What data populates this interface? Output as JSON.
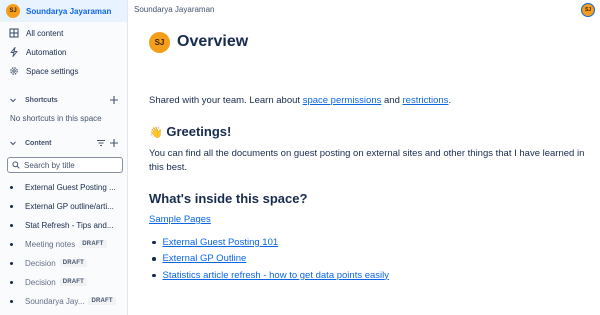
{
  "space": {
    "avatar_initials": "SJ",
    "name": "Soundarya Jayaraman"
  },
  "nav": {
    "all_content": "All content",
    "automation": "Automation",
    "space_settings": "Space settings"
  },
  "shortcuts": {
    "label": "Shortcuts",
    "empty_text": "No shortcuts in this space"
  },
  "content": {
    "label": "Content",
    "search_placeholder": "Search by title",
    "items": [
      {
        "title": "External Guest Posting ...",
        "badge": ""
      },
      {
        "title": "External GP outline/arti...",
        "badge": ""
      },
      {
        "title": "Stat Refresh - Tips and...",
        "badge": ""
      },
      {
        "title": "Meeting notes",
        "badge": "DRAFT"
      },
      {
        "title": "Decision",
        "badge": "DRAFT"
      },
      {
        "title": "Decision",
        "badge": "DRAFT"
      },
      {
        "title": "Soundarya Jay...",
        "badge": "DRAFT"
      }
    ]
  },
  "topbar": {
    "breadcrumb": "Soundarya Jayaraman",
    "avatar_initials": "SJ"
  },
  "page": {
    "avatar_initials": "SJ",
    "title": "Overview",
    "intro_text": "Shared with your team. Learn about",
    "intro_link1": "space permissions",
    "intro_and": "and",
    "intro_link2": "restrictions",
    "intro_end": ".",
    "greeting_emoji": "👋",
    "greeting_heading": "Greetings!",
    "greeting_body": "You can find all the documents on guest posting on external sites and other things that I have learned in this best.",
    "inside_heading": "What's inside this space?",
    "sample_pages": "Sample Pages",
    "links": [
      "External Guest Posting 101",
      "External GP Outline",
      "Statistics article refresh - how to get data points easily"
    ]
  },
  "colors": {
    "accent": "#0c66e4",
    "avatar": "#f59e1b",
    "text": "#172b4d"
  }
}
